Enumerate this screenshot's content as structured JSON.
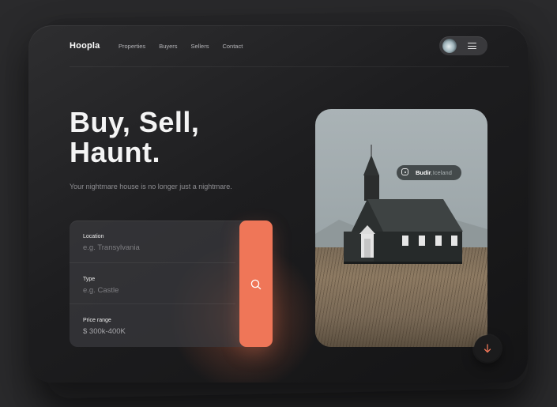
{
  "brand": {
    "name": "Hoopla"
  },
  "nav": {
    "links": [
      "Properties",
      "Buyers",
      "Sellers",
      "Contact"
    ]
  },
  "hero": {
    "title_line1": "Buy, Sell,",
    "title_line2": "Haunt.",
    "subtitle": "Your nightmare house is no longer just a nightmare."
  },
  "search": {
    "fields": [
      {
        "label": "Location",
        "value": "e.g. Transylvania"
      },
      {
        "label": "Type",
        "value": "e.g. Castle"
      },
      {
        "label": "Price range",
        "value": "$ 300k-400K"
      }
    ]
  },
  "location_tag": {
    "place": "Budir",
    "separator": ", ",
    "country": "Iceland"
  },
  "icons": {
    "menu": "hamburger-menu-icon",
    "search": "search-icon",
    "location": "map-pin-icon",
    "scroll": "arrow-down-icon"
  },
  "colors": {
    "accent": "#ef7658",
    "background": "#2a2a2c",
    "card": "#1d1d1f",
    "text_primary": "#f4f4f4",
    "text_muted": "#8e8e92"
  }
}
